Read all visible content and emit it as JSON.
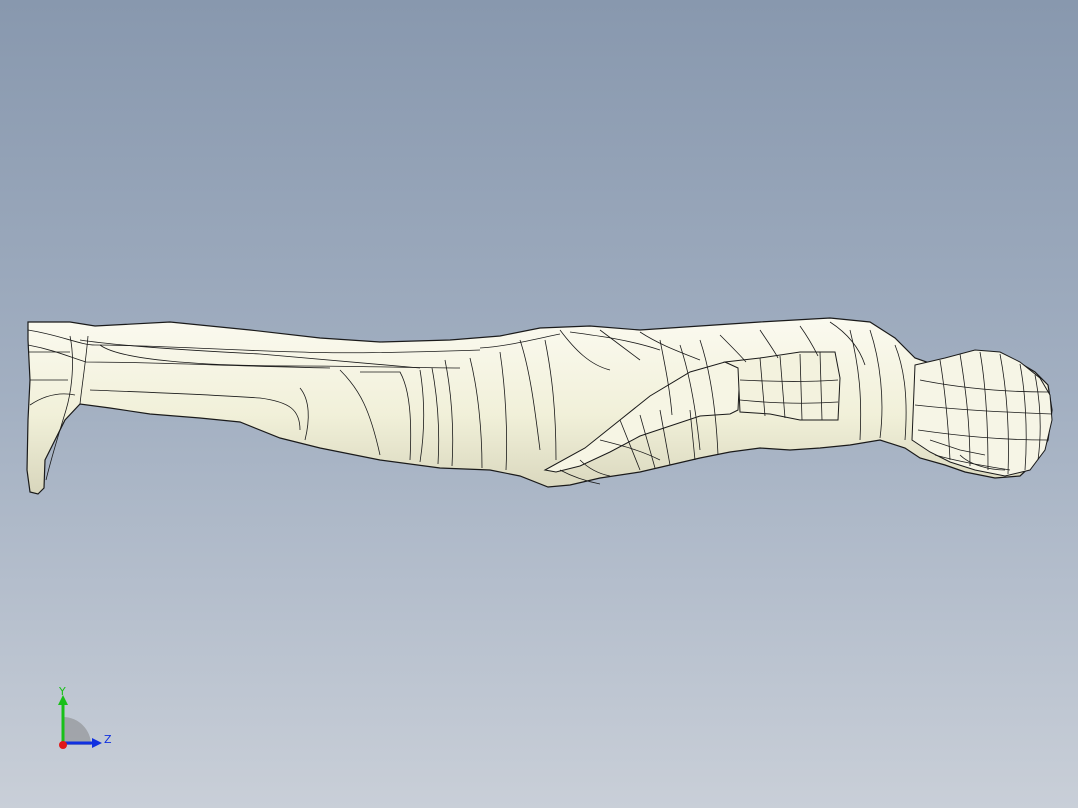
{
  "viewport": {
    "background_top": "#8898ae",
    "background_bottom": "#c9cfd8"
  },
  "model": {
    "name": "human-figure",
    "fill_color": "#f4f3e2",
    "edge_color": "#1a1a1a"
  },
  "triad": {
    "y_label": "Y",
    "z_label": "Z",
    "y_color": "#18c018",
    "z_color": "#1030e0",
    "x_color": "#e01818"
  }
}
